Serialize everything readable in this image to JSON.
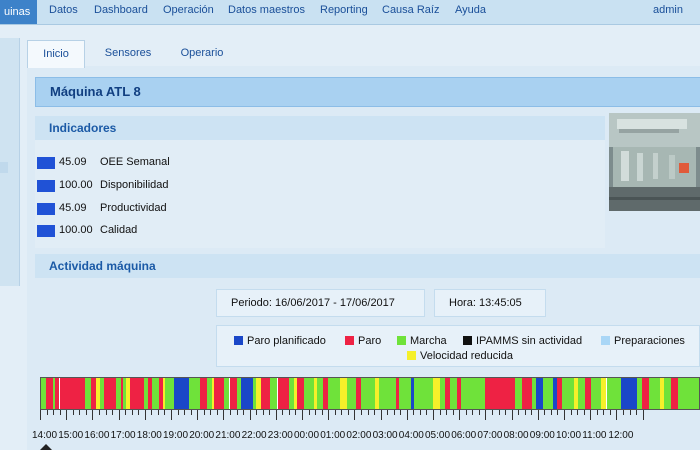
{
  "nav": {
    "items": [
      "uinas",
      "Datos",
      "Dashboard",
      "Operación",
      "Datos maestros",
      "Reporting",
      "Causa Raíz",
      "Ayuda"
    ],
    "user": "admin"
  },
  "tabs": [
    "Inicio",
    "Sensores",
    "Operario"
  ],
  "machine": {
    "title": "Máquina ATL 8"
  },
  "indicators": {
    "heading": "Indicadores",
    "color": "#2052d6",
    "rows": [
      {
        "value": "45.09",
        "label": "OEE Semanal"
      },
      {
        "value": "100.00",
        "label": "Disponibilidad"
      },
      {
        "value": "45.09",
        "label": "Productividad"
      },
      {
        "value": "100.00",
        "label": "Calidad"
      }
    ]
  },
  "activity": {
    "heading": "Actividad máquina",
    "period": "Periodo:   16/06/2017 - 17/06/2017",
    "time": "Hora:   13:45:05"
  },
  "legend": [
    {
      "label": "Paro planificado",
      "color": "#1a47c8"
    },
    {
      "label": "Paro",
      "color": "#ee2244"
    },
    {
      "label": "Marcha",
      "color": "#6fe23a"
    },
    {
      "label": "IPAMMS sin actividad",
      "color": "#111111"
    },
    {
      "label": "Preparaciones",
      "color": "#a9d6f6"
    },
    {
      "label": "Velocidad reducida",
      "color": "#f5f02a"
    }
  ],
  "timeline": {
    "hours": [
      "14:00",
      "15:00",
      "16:00",
      "17:00",
      "18:00",
      "19:00",
      "20:00",
      "21:00",
      "22:00",
      "23:00",
      "00:00",
      "01:00",
      "02:00",
      "03:00",
      "04:00",
      "05:00",
      "06:00",
      "07:00",
      "08:00",
      "09:00",
      "10:00",
      "11:00",
      "12:00"
    ]
  }
}
